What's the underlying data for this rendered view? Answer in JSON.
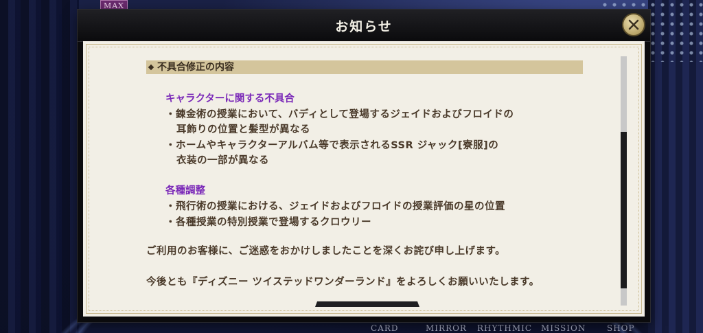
{
  "background": {
    "badge": "MAX",
    "nav_items": [
      "CARD",
      "MIRROR",
      "RHYTHMIC",
      "MISSION",
      "SHOP"
    ]
  },
  "dialog": {
    "title": "お知らせ",
    "close_icon": "close-icon",
    "section_header": "不具合修正の内容",
    "groups": [
      {
        "heading": "キャラクターに関する不具合",
        "lines": [
          "・錬金術の授業において、バディとして登場するジェイドおよびフロイドの",
          "耳飾りの位置と髪型が異なる",
          "・ホームやキャラクターアルバム等で表示されるSSR ジャック[寮服]の",
          "衣装の一部が異なる"
        ]
      },
      {
        "heading": "各種調整",
        "lines": [
          "・飛行術の授業における、ジェイドおよびフロイドの授業評価の星の位置",
          "・各種授業の特別授業で登場するクロウリー"
        ]
      }
    ],
    "apology": "ご利用のお客様に、ご迷惑をおかけしましたことを深くお詫び申し上げます。",
    "closing": "今後とも『ディズニー ツイステッドワンダーランド』をよろしくお願いいたします。"
  },
  "colors": {
    "heading_purple": "#7a28b8",
    "section_bg": "#d4c59c",
    "paper": "#f2efe6",
    "text": "#4a3a2a"
  }
}
